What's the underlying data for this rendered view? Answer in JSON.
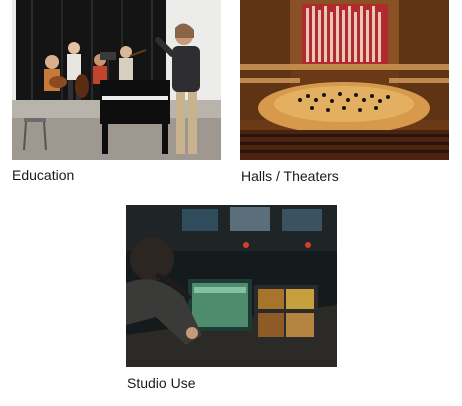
{
  "gallery": {
    "items": [
      {
        "caption": "Education"
      },
      {
        "caption": "Halls / Theaters"
      },
      {
        "caption": "Studio Use"
      }
    ]
  }
}
